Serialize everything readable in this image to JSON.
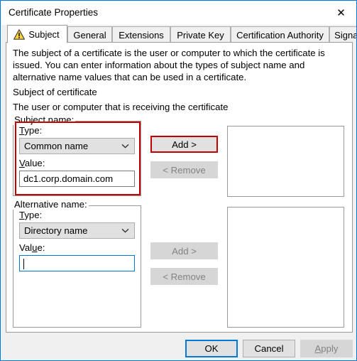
{
  "window": {
    "title": "Certificate Properties",
    "close_icon": "close-icon",
    "accent_color": "#0078d7",
    "highlight_color": "#c00000"
  },
  "tabs": [
    {
      "label": "Subject",
      "active": true,
      "icon": "warning-triangle-icon"
    },
    {
      "label": "General",
      "active": false
    },
    {
      "label": "Extensions",
      "active": false
    },
    {
      "label": "Private Key",
      "active": false
    },
    {
      "label": "Certification Authority",
      "active": false
    },
    {
      "label": "Signature",
      "active": false
    }
  ],
  "subject_tab": {
    "description": "The subject of a certificate is the user or computer to which the certificate is issued. You can enter information about the types of subject name and alternative name values that can be used in a certificate.",
    "section_heading": "Subject of certificate",
    "section_subtext": "The user or computer that is receiving the certificate",
    "subject_name": {
      "group_label": "Subject name:",
      "type_label_pre": "",
      "type_label_accel": "T",
      "type_label_post": "ype:",
      "type_value": "Common name",
      "type_options": [
        "Common name"
      ],
      "value_label_accel": "V",
      "value_label_post": "alue:",
      "value_text": "dc1.corp.domain.com",
      "add_label": "Add >",
      "remove_label": "< Remove",
      "add_enabled": true,
      "remove_enabled": false,
      "list_items": []
    },
    "alternative_name": {
      "group_label": "Alternative name:",
      "type_label_pre": "",
      "type_label_accel": "T",
      "type_label_post": "ype:",
      "type_value": "Directory name",
      "type_options": [
        "Directory name"
      ],
      "value_label_pre": "Val",
      "value_label_accel": "u",
      "value_label_post": "e:",
      "value_text": "",
      "add_label": "Add >",
      "remove_label": "< Remove",
      "add_enabled": false,
      "remove_enabled": false,
      "list_items": []
    }
  },
  "footer": {
    "ok_label": "OK",
    "cancel_label": "Cancel",
    "apply_label_pre": "",
    "apply_label_accel": "A",
    "apply_label_post": "pply",
    "apply_enabled": false
  }
}
